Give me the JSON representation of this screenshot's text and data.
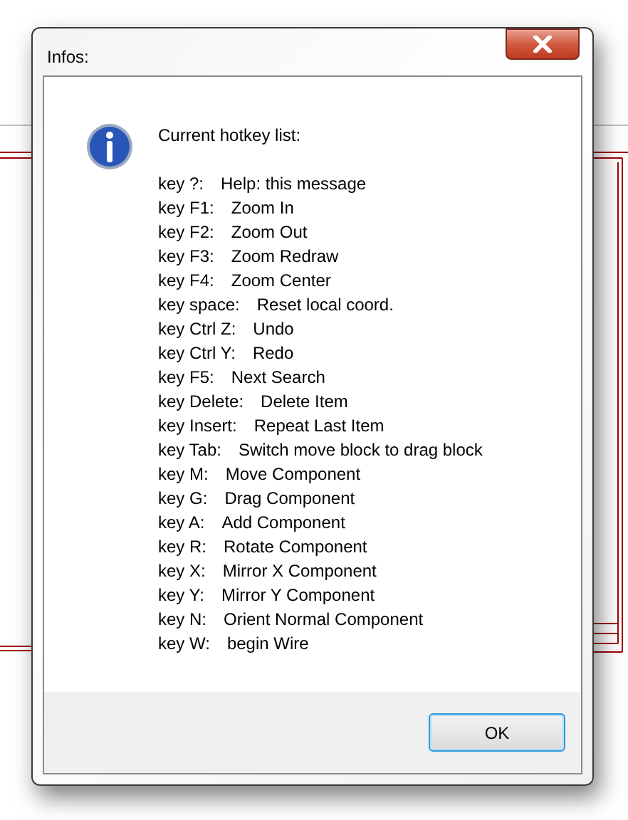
{
  "window": {
    "title": "Infos:"
  },
  "message": {
    "heading": "Current hotkey list:",
    "hotkeys": [
      {
        "key": "key ?:",
        "action": "Help: this message"
      },
      {
        "key": "key F1:",
        "action": "Zoom In"
      },
      {
        "key": "key F2:",
        "action": "Zoom Out"
      },
      {
        "key": "key F3:",
        "action": "Zoom Redraw"
      },
      {
        "key": "key F4:",
        "action": "Zoom Center"
      },
      {
        "key": "key space:",
        "action": "Reset local coord."
      },
      {
        "key": "key Ctrl Z:",
        "action": "Undo"
      },
      {
        "key": "key Ctrl Y:",
        "action": "Redo"
      },
      {
        "key": "key F5:",
        "action": "Next Search"
      },
      {
        "key": "key Delete:",
        "action": "Delete Item"
      },
      {
        "key": "key Insert:",
        "action": "Repeat Last Item"
      },
      {
        "key": "key Tab:",
        "action": "Switch move block to drag block"
      },
      {
        "key": "key M:",
        "action": "Move Component"
      },
      {
        "key": "key G:",
        "action": "Drag Component"
      },
      {
        "key": "key A:",
        "action": "Add Component"
      },
      {
        "key": "key R:",
        "action": "Rotate Component"
      },
      {
        "key": "key X:",
        "action": "Mirror X Component"
      },
      {
        "key": "key Y:",
        "action": "Mirror Y Component"
      },
      {
        "key": "key N:",
        "action": "Orient Normal Component"
      },
      {
        "key": "key W:",
        "action": "begin Wire"
      }
    ]
  },
  "buttons": [
    "OK"
  ]
}
